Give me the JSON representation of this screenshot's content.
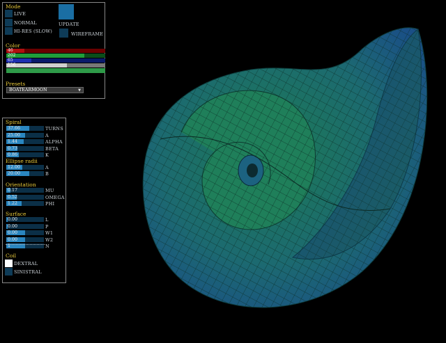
{
  "mode": {
    "heading": "Mode",
    "live": "LIVE",
    "normal": "NORMAL",
    "hires": "HI-RES (SLOW)",
    "update": "UPDATE",
    "wireframe": "WIREFRAME"
  },
  "color": {
    "heading": "Color",
    "bars": [
      {
        "value": "46",
        "fraction": 0.18,
        "track": "#6a0000",
        "fill": "#b01010"
      },
      {
        "value": "202",
        "fraction": 0.79,
        "track": "#0a4d1a",
        "fill": "#1f9e3a"
      },
      {
        "value": "65",
        "fraction": 0.25,
        "track": "#0a1a6a",
        "fill": "#1e2fb0"
      },
      {
        "value": "156",
        "fraction": 0.61,
        "track": "#777777",
        "fill": "#cfcfcf"
      }
    ],
    "swatch": "#2e9a48"
  },
  "presets": {
    "heading": "Presets",
    "selected": "BOATEARMOON"
  },
  "spiral": {
    "heading": "Spiral",
    "rows": [
      {
        "value": "37.66",
        "label": "TURNS",
        "fraction": 0.62
      },
      {
        "value": "25.00",
        "label": "A",
        "fraction": 0.5
      },
      {
        "value": "1.44",
        "label": "ALPHA",
        "fraction": 0.46
      },
      {
        "value": "0.73",
        "label": "BETA",
        "fraction": 0.3
      },
      {
        "value": "0.86",
        "label": "K",
        "fraction": 0.34
      }
    ]
  },
  "ellipse": {
    "heading": "Ellipse radii",
    "rows": [
      {
        "value": "12.00",
        "label": "A",
        "fraction": 0.42
      },
      {
        "value": "20.00",
        "label": "B",
        "fraction": 0.62
      }
    ]
  },
  "orientation": {
    "heading": "Orientation",
    "rows": [
      {
        "value": "0.17",
        "label": "MU",
        "fraction": 0.12
      },
      {
        "value": "0.52",
        "label": "OMEGA",
        "fraction": 0.28
      },
      {
        "value": "1.22",
        "label": "PHI",
        "fraction": 0.4
      }
    ]
  },
  "surface": {
    "heading": "Surface",
    "rows": [
      {
        "value": "0.00",
        "label": "L",
        "fraction": 0.04
      },
      {
        "value": "0.00",
        "label": "P",
        "fraction": 0.04
      },
      {
        "value": "0.00",
        "label": "W1",
        "fraction": 0.5
      },
      {
        "value": "0.00",
        "label": "W2",
        "fraction": 0.5
      },
      {
        "value": "1",
        "label": "N",
        "fraction": 0.5
      }
    ]
  },
  "coil": {
    "heading": "Coil",
    "dextral": "DEXTRAL",
    "sinistral": "SINISTRAL"
  }
}
